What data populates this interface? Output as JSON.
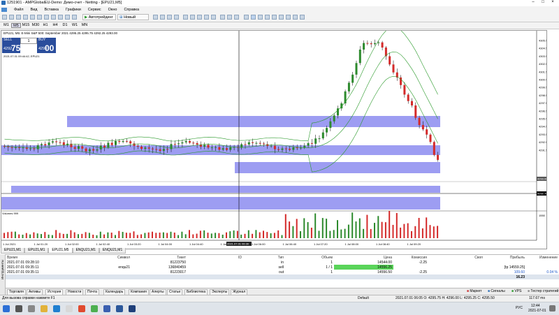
{
  "window": {
    "title": "1251901 - AMPGlobalEU-Demo: Демо-счет - Netting - [EPU21,M5]",
    "buttons": [
      "–",
      "□",
      "×"
    ]
  },
  "menu": [
    "Файл",
    "Вид",
    "Вставка",
    "Графики",
    "Сервис",
    "Окно",
    "Справка"
  ],
  "toolbar": {
    "algo_label": "Автотрейдинг",
    "new_order_label": "Новый ордер"
  },
  "timeframes": [
    "M1",
    "M5",
    "M15",
    "M30",
    "H1",
    "H4",
    "D1",
    "W1",
    "MN"
  ],
  "active_timeframe": "M5",
  "chart": {
    "info_line": "EPU21, M5:  E-Mini S&P 500: September 2021  4295.25 4295.75 4292.25 4293.00",
    "sub_line": "2021.07.01 09:44:42, EPU21",
    "volume_label": "Volumes 999",
    "trade_panel": {
      "sell_label": "SELL",
      "buy_label": "BUY",
      "lot": "1",
      "sell_price_small": "4292",
      "sell_price_big": "75",
      "buy_price_small": "4293",
      "buy_price_big": "00"
    },
    "price_labels": [
      "4305.50",
      "4304.50",
      "4303.50",
      "4302.50",
      "4301.50",
      "4300.50",
      "4299.50",
      "4298.50",
      "4297.50",
      "4296.50",
      "4295.50",
      "4294.50",
      "4293.50",
      "4292.50",
      "4291.50"
    ],
    "current_price": "4293.00",
    "ask_label": "4292.75",
    "vol_scale": "1550",
    "time_labels": [
      "1 Jul 2021",
      "1 Jul 01:20",
      "1 Jul 02:00",
      "1 Jul 02:40",
      "1 Jul 03:20",
      "1 Jul 04:00",
      "1 Jul 04:40",
      "1 Jul 05:20",
      "1 Jul 06:00",
      "1 Jul 06:40",
      "1 Jul 07:20",
      "1 Jul 08:00",
      "1 Jul 08:40",
      "1 Jul 09:20"
    ],
    "cursor_time": "2021.07.01 06:30",
    "tabs": [
      "EPU21,M1",
      "EPU21,M1",
      "EPU21,M5",
      "ENQU21,M1",
      "ENQU21,M1"
    ]
  },
  "terminal": {
    "side_label": "Инструменты",
    "columns": [
      "Время",
      "Символ",
      "Тикет",
      "ID",
      "Тип",
      "Объем",
      "Цена",
      "Комиссия",
      "Своп",
      "Прибыль",
      "Изменение"
    ],
    "rows": [
      {
        "time": "2021.07.01 09:28:10",
        "symbol": "",
        "ticket": "81223750",
        "id": "",
        "type": "in",
        "volume": "1",
        "price": "14544.00",
        "commission": "-2.25",
        "swap": "",
        "profit": "",
        "change": ""
      },
      {
        "time": "2021.07.01 09:35:11",
        "symbol": "enqu21",
        "ticket": "136840459",
        "id": "",
        "type": "sell",
        "volume": "1 / 1",
        "price": "14556.25",
        "commission": "",
        "swap": "",
        "profit": "[tp 14559.25]",
        "change": ""
      },
      {
        "time": "2021.07.01 09:35:11",
        "symbol": "",
        "ticket": "81223017",
        "id": "",
        "type": "out",
        "volume": "1",
        "price": "14556.50",
        "commission": "-2.25",
        "swap": "",
        "profit": "109.60",
        "change": "0.04 %"
      }
    ],
    "total": "16.23"
  },
  "bottom_tabs": [
    "Торговля",
    "Активы",
    "История",
    "Новости",
    "Почта",
    "Календарь",
    "Компания",
    "Алерты",
    "Статьи",
    "Библиотека",
    "Эксперты",
    "Журнал"
  ],
  "right_tabs": [
    "Маркет",
    "Сигналы",
    "VPS",
    "Тестер стратегий"
  ],
  "status": {
    "help": "Для вызова справки нажмите F1",
    "profile": "Default",
    "ohlc": "2021.07.01 06:05  O: 4295.75  H: 4296.00  L: 4295.25  C: 4295.50",
    "speed": "117.67 ms"
  },
  "taskbar": {
    "lang": "РУС",
    "time": "12:44",
    "date": "2021-07-01"
  },
  "colors": {
    "up": "#2d8a2d",
    "down": "#d42a2a",
    "zone": "#8c8cf0",
    "band": "#2b9a2b"
  }
}
